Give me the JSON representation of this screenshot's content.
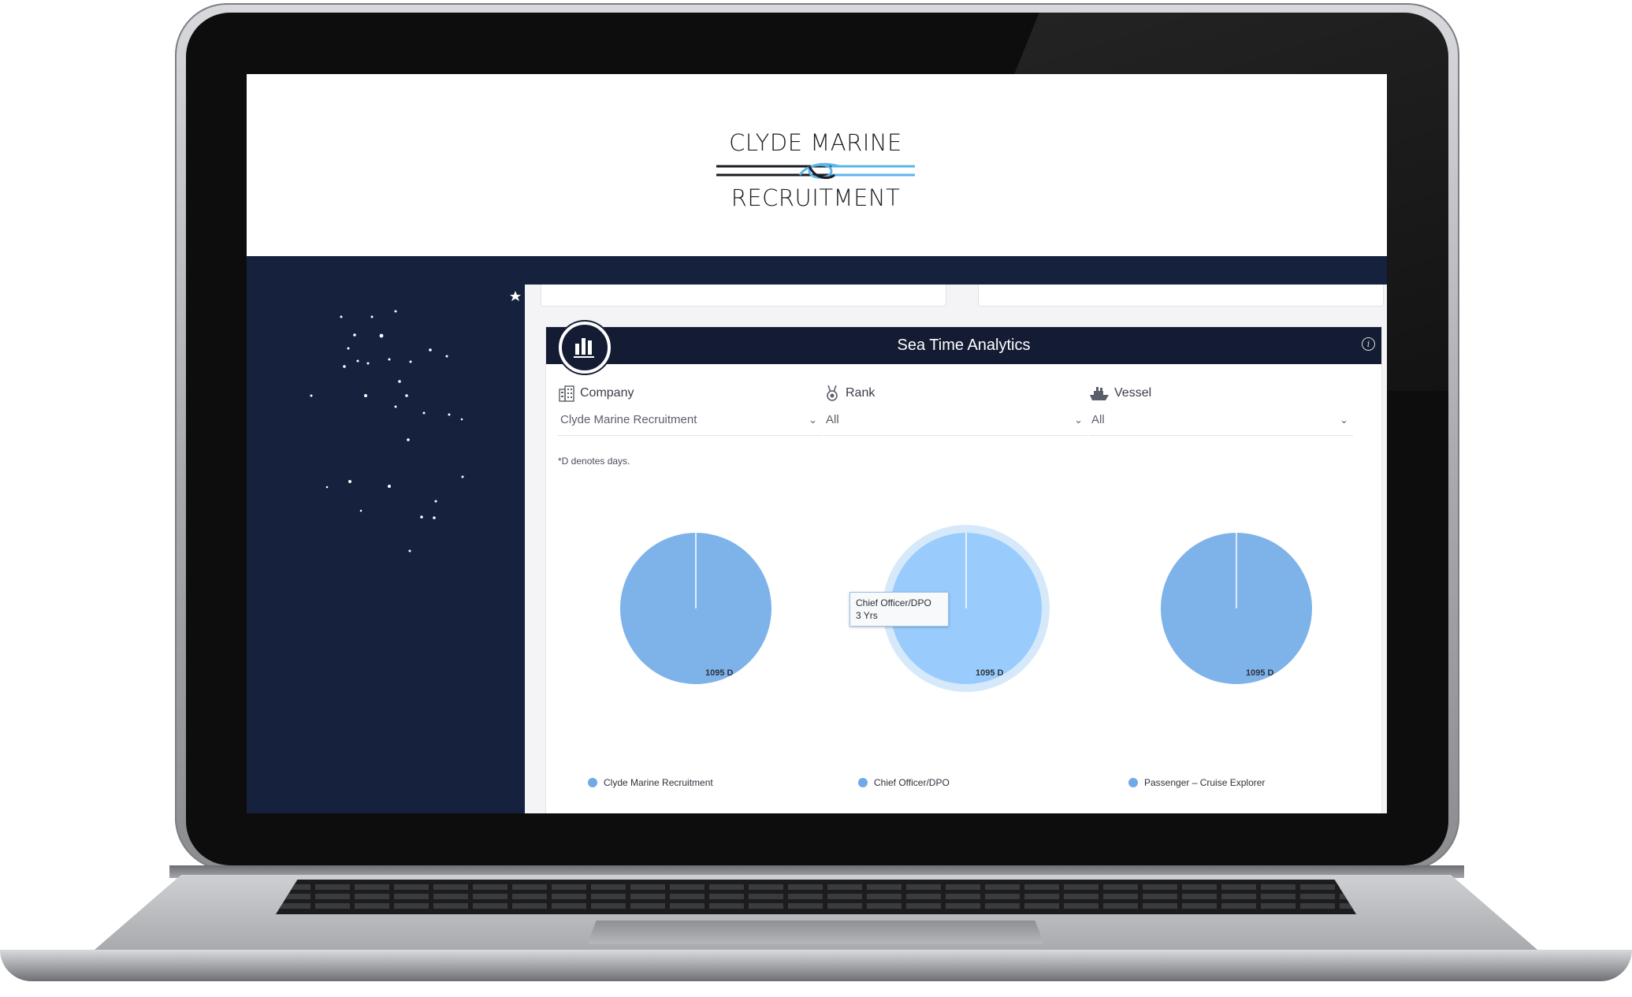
{
  "brand": {
    "line1": "CLYDE MARINE",
    "line2": "RECRUITMENT"
  },
  "panel": {
    "title": "Sea Time Analytics",
    "header_icon": "bar-chart-icon",
    "info_icon": "info-icon",
    "info_glyph": "i"
  },
  "filters": [
    {
      "label": "Company",
      "icon": "building-icon",
      "value": "Clyde Marine Recruitment"
    },
    {
      "label": "Rank",
      "icon": "medal-icon",
      "value": "All"
    },
    {
      "label": "Vessel",
      "icon": "ship-icon",
      "value": "All"
    }
  ],
  "note": "*D denotes days.",
  "tooltip": {
    "line1": "Chief Officer/DPO",
    "line2": "3 Yrs"
  },
  "colors": {
    "navy": "#15213d",
    "pie": "#7eb3ea",
    "pie_hover": "#99ccfd"
  },
  "chart_data": [
    {
      "type": "pie",
      "series": [
        {
          "name": "Clyde Marine Recruitment",
          "values": [
            1095
          ]
        }
      ],
      "data_label": "1095 D"
    },
    {
      "type": "pie",
      "series": [
        {
          "name": "Chief Officer/DPO",
          "values": [
            1095
          ]
        }
      ],
      "data_label": "1095 D"
    },
    {
      "type": "pie",
      "series": [
        {
          "name": "Passenger – Cruise Explorer",
          "values": [
            1095
          ]
        }
      ],
      "data_label": "1095 D"
    }
  ]
}
